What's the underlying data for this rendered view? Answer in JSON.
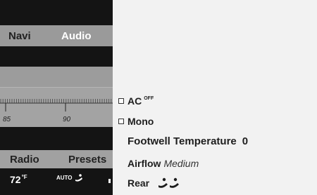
{
  "nav": {
    "navi_label": "Navi",
    "audio_label": "Audio"
  },
  "scale": {
    "labels": [
      "85",
      "90"
    ]
  },
  "bottom_bar": {
    "radio_label": "Radio",
    "presets_label": "Presets"
  },
  "climate": {
    "temperature": "72",
    "temperature_unit": "°F",
    "mode_label": "AUTO",
    "mode_icon": "airflow-icon"
  },
  "menu": {
    "ac_label": "AC",
    "ac_state": "OFF",
    "mono_label": "Mono",
    "footwell_label": "Footwell Temperature",
    "footwell_value": "0",
    "airflow_label": "Airflow",
    "airflow_value": "Medium",
    "rear_label": "Rear",
    "rear_icon": "rear-airflow-icon"
  },
  "colors": {
    "panel_dark": "#141414",
    "band_gray": "#9c9c9c",
    "menu_bg": "#f2f2f2",
    "text_dark": "#1e1e1e"
  }
}
